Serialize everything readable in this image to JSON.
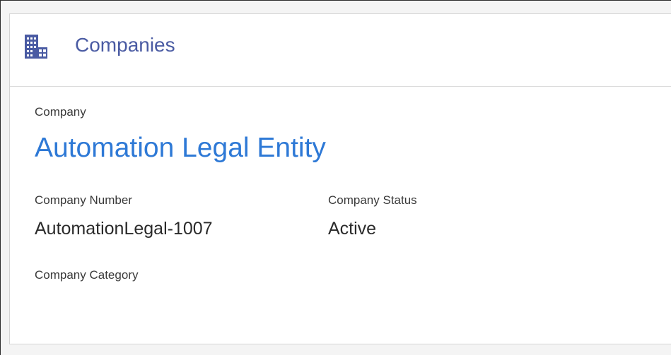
{
  "card": {
    "title": "Companies",
    "icon": "building-icon",
    "accent_color": "#4a5ba3",
    "link_color": "#2e79d6"
  },
  "company": {
    "label": "Company",
    "name": "Automation Legal Entity"
  },
  "fields": {
    "number_label": "Company Number",
    "number_value": "AutomationLegal-1007",
    "status_label": "Company Status",
    "status_value": "Active",
    "category_label": "Company Category"
  }
}
